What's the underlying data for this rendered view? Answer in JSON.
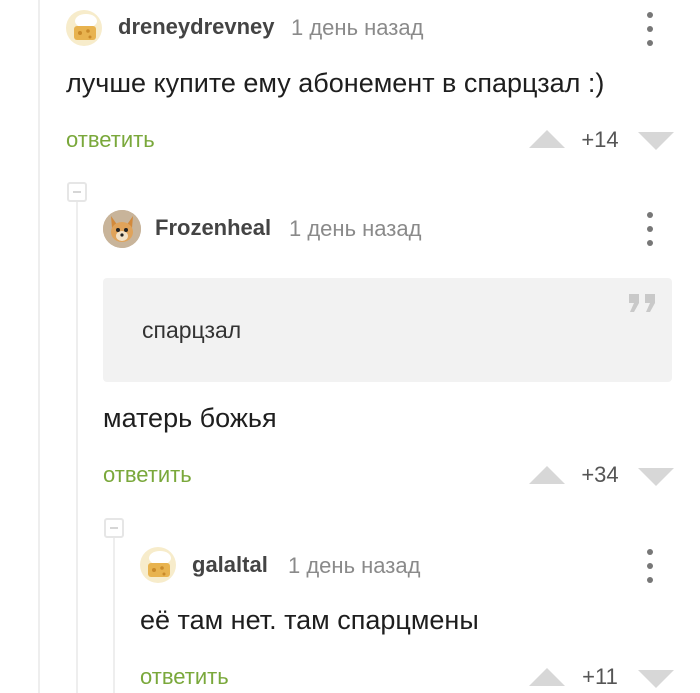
{
  "comments": [
    {
      "author": "dreneydrevney",
      "time": "1 день назад",
      "text": "лучше купите ему абонемент в спарцзал :)",
      "reply_label": "ответить",
      "score": "+14"
    },
    {
      "author": "Frozenheal",
      "time": "1 день назад",
      "quote": "спарцзал",
      "text": "матерь божья",
      "reply_label": "ответить",
      "score": "+34"
    },
    {
      "author": "galaltal",
      "time": "1 день назад",
      "text": "её там нет. там спарцмены",
      "reply_label": "ответить",
      "score": "+11"
    }
  ],
  "icons": {
    "vote_up": "triangle-up-icon",
    "vote_down": "triangle-down-icon",
    "menu": "more-vertical-icon",
    "quote": "quote-icon",
    "collapse": "collapse-minus-icon"
  },
  "colors": {
    "reply": "#7aa83b",
    "vote_arrows": "#d7d7d7",
    "thread_line": "#eeeeee",
    "quote_background": "#f2f2f2"
  }
}
